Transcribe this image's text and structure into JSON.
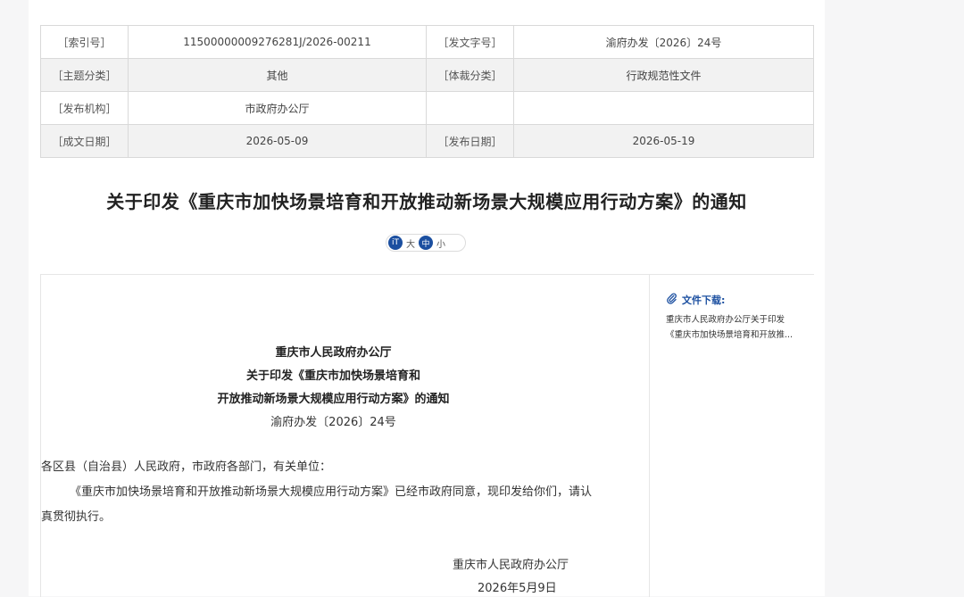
{
  "meta": {
    "index_label": "［索引号］",
    "index_value": "11500000009276281J/2026-00211",
    "docno_label": "［发文字号］",
    "docno_value": "渝府办发〔2026〕24号",
    "topic_label": "［主题分类］",
    "topic_value": "其他",
    "genre_label": "［体裁分类］",
    "genre_value": "行政规范性文件",
    "issuer_label": "［发布机构］",
    "issuer_value": "市政府办公厅",
    "written_label": "［成文日期］",
    "written_value": "2026-05-09",
    "published_label": "［发布日期］",
    "published_value": "2026-05-19"
  },
  "title": "关于印发《重庆市加快场景培育和开放推动新场景大规模应用行动方案》的通知",
  "font_size": {
    "icon_label": "iT",
    "large": "大",
    "medium": "中",
    "small": "小"
  },
  "download": {
    "title": "文件下载:",
    "link_line1": "重庆市人民政府办公厅关于印发",
    "link_line2": "《重庆市加快场景培育和开放推..."
  },
  "article": {
    "org": "重庆市人民政府办公厅",
    "heading1": "关于印发《重庆市加快场景培育和",
    "heading2": "开放推动新场景大规模应用行动方案》的通知",
    "doc_no": "渝府办发〔2026〕24号",
    "salutation": "各区县（自治县）人民政府，市政府各部门，有关单位：",
    "body_line1": "《重庆市加快场景培育和开放推动新场景大规模应用行动方案》已经市政府同意，现印发给你们，请认",
    "body_line2": "真贯彻执行。",
    "signature": "重庆市人民政府办公厅",
    "date": "2026年5月9日"
  },
  "colors": {
    "accent": "#1b4fa0",
    "row_alt": "#f2f2f2",
    "border": "#d9d9d9"
  }
}
